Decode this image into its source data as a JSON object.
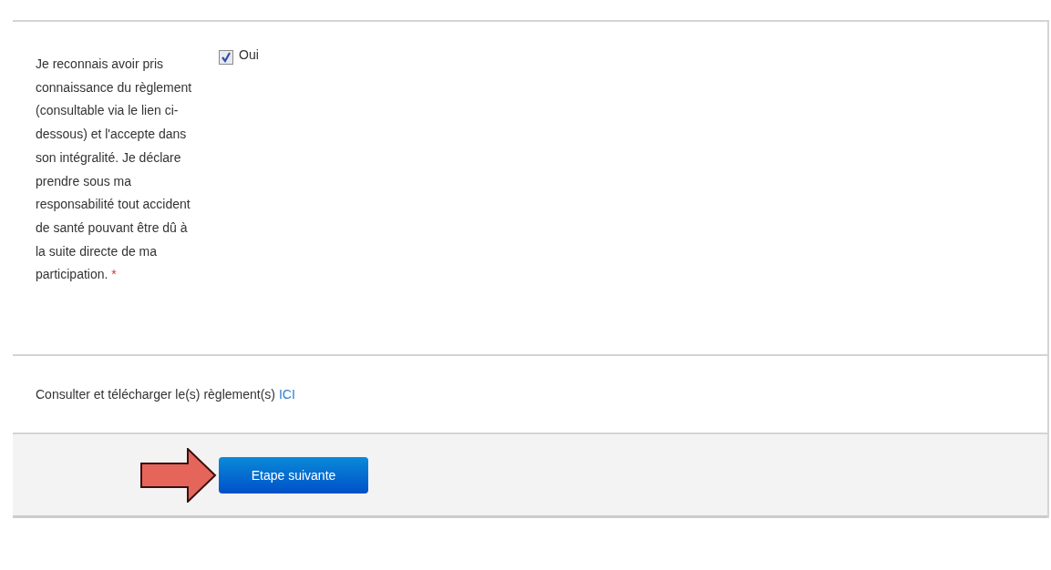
{
  "consent": {
    "label": "Je reconnais avoir pris connaissance du règlement (consultable via le lien ci-dessous) et l'accepte dans son intégralité. Je déclare prendre sous ma responsabilité tout accident de santé pouvant être dû à la suite directe de ma participation.",
    "required_mark": "*",
    "option": {
      "label": "Oui",
      "checked": true
    }
  },
  "rules_note": {
    "text": "Consulter et télécharger le(s) règlement(s)",
    "link": "ICI"
  },
  "footer": {
    "button": "Etape suivante"
  }
}
